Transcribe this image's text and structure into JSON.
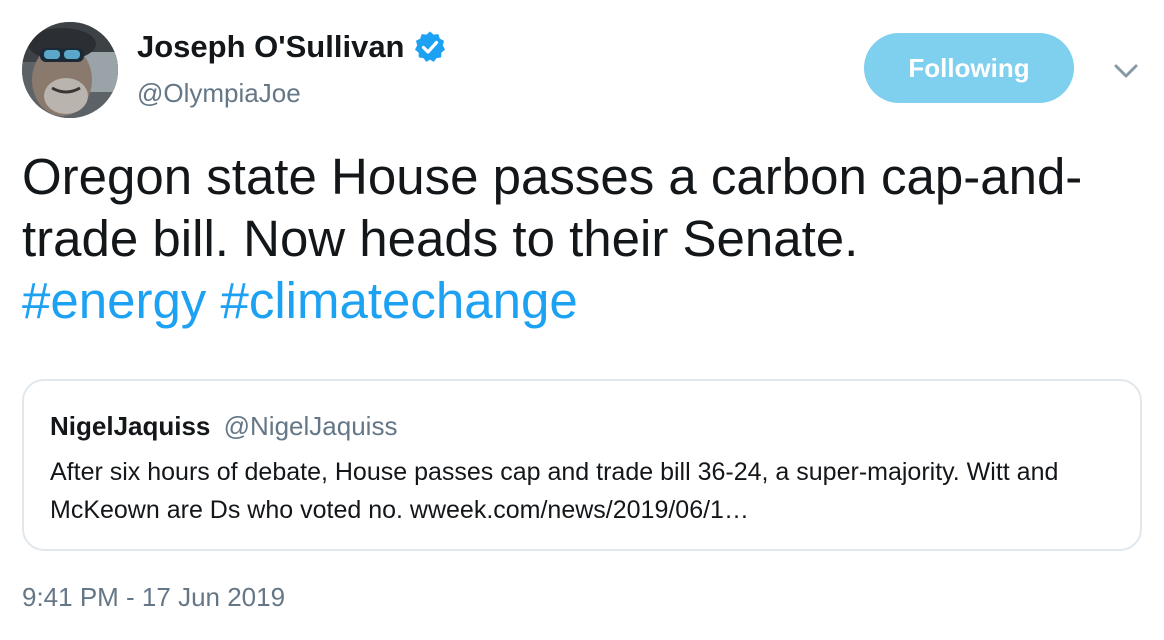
{
  "author": {
    "name": "Joseph O'Sullivan",
    "handle": "@OlympiaJoe",
    "verified": true
  },
  "follow_button": {
    "label": "Following"
  },
  "tweet": {
    "text": "Oregon state House passes a carbon cap-and-trade bill. Now heads to their Senate.",
    "hashtags": [
      "#energy",
      "#climatechange"
    ]
  },
  "quoted_tweet": {
    "name": "NigelJaquiss",
    "handle": "@NigelJaquiss",
    "text": "After six hours of debate, House passes cap and trade bill 36-24, a super-majority. Witt and McKeown are Ds who voted no. wweek.com/news/2019/06/1…"
  },
  "timestamp": "9:41 PM - 17 Jun 2019",
  "icons": {
    "verified": "verified-badge-icon",
    "menu": "chevron-down-icon"
  },
  "colors": {
    "accent": "#1da1f2",
    "following_button": "#7fcfee",
    "secondary_text": "#657786",
    "border": "#e1e8ed"
  }
}
